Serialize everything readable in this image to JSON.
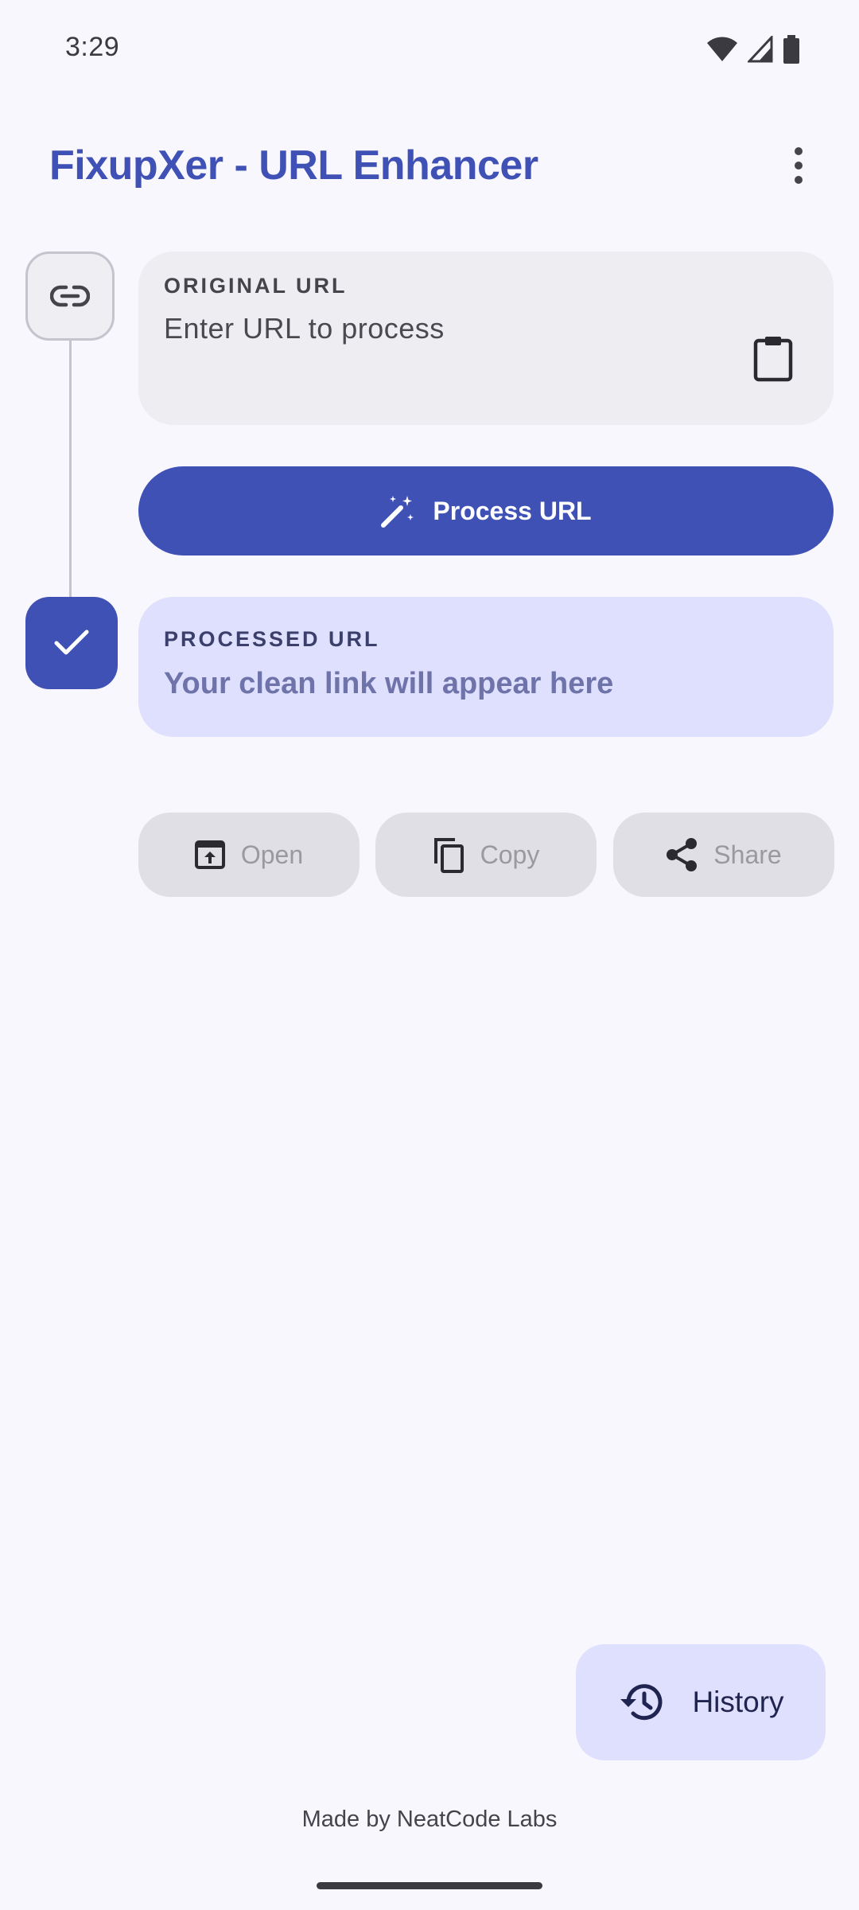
{
  "status_bar": {
    "time": "3:29",
    "icons": [
      "wifi-icon",
      "cellular-signal-icon",
      "battery-icon"
    ]
  },
  "app_bar": {
    "title": "FixupXer - URL Enhancer",
    "menu_icon": "more-vert-icon"
  },
  "original": {
    "label": "ORIGINAL URL",
    "placeholder": "Enter URL to process",
    "value": "",
    "paste_icon": "clipboard-icon",
    "step_icon": "link-icon"
  },
  "process_button": {
    "label": "Process URL",
    "icon": "magic-wand-icon"
  },
  "processed": {
    "label": "PROCESSED URL",
    "value": "Your clean link will appear here",
    "step_icon": "check-icon"
  },
  "actions": {
    "open": {
      "label": "Open",
      "icon": "open-in-browser-icon"
    },
    "copy": {
      "label": "Copy",
      "icon": "copy-icon"
    },
    "share": {
      "label": "Share",
      "icon": "share-icon"
    }
  },
  "history_button": {
    "label": "History",
    "icon": "history-icon"
  },
  "footer": {
    "text": "Made by NeatCode Labs"
  },
  "colors": {
    "primary": "#3f51b5",
    "background": "#f9f7fe",
    "processed_card": "#dfe0fd",
    "original_card": "#eeedf2",
    "disabled_button": "#e0dfe5"
  }
}
